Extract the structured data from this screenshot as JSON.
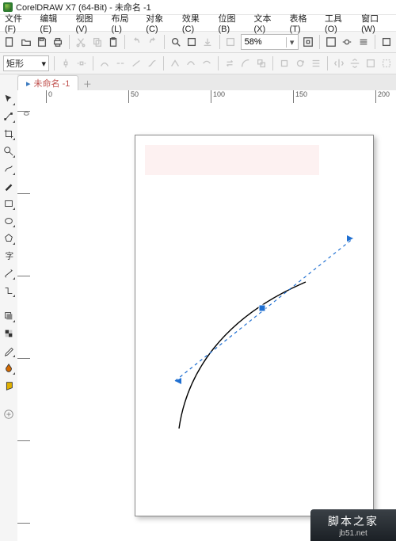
{
  "title": "CorelDRAW X7 (64-Bit) - 未命名 -1",
  "menu": [
    "文件(F)",
    "编辑(E)",
    "视图(V)",
    "布局(L)",
    "对象(C)",
    "效果(C)",
    "位图(B)",
    "文本(X)",
    "表格(T)",
    "工具(O)",
    "窗口(W)"
  ],
  "zoom": "58%",
  "shape_preset": "矩形",
  "doc_tab": "未命名 -1",
  "ruler_h": [
    {
      "p": 36,
      "l": "0"
    },
    {
      "p": 140,
      "l": "50"
    },
    {
      "p": 244,
      "l": "100"
    },
    {
      "p": 348,
      "l": "150"
    },
    {
      "p": 452,
      "l": "200"
    }
  ],
  "ruler_v": [
    {
      "p": 10,
      "l": "0"
    },
    {
      "p": 114,
      "l": ""
    },
    {
      "p": 218,
      "l": ""
    },
    {
      "p": 322,
      "l": ""
    },
    {
      "p": 426,
      "l": ""
    },
    {
      "p": 530,
      "l": ""
    }
  ],
  "badge": {
    "big": "脚本之家",
    "small": "jb51.net"
  }
}
